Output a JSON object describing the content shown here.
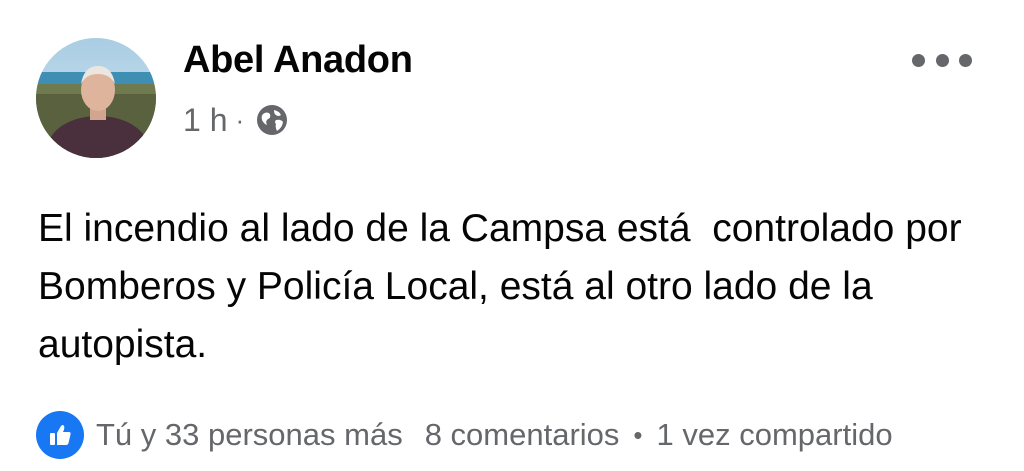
{
  "post": {
    "author_name": "Abel Anadon",
    "time": "1 h",
    "separator": "·",
    "privacy_icon": "globe-icon",
    "more_icon": "more-horizontal-icon",
    "text": "El incendio al lado de la Campsa está  controlado por Bomberos y Policía Local, está al otro lado de la autopista.",
    "reactions": {
      "icon": "like-icon",
      "label": "Tú y 33 personas más"
    },
    "comments_label": "8 comentarios",
    "dot": "•",
    "shares_label": "1 vez compartido"
  },
  "colors": {
    "like_blue": "#1877f2",
    "secondary_text": "#65676b",
    "primary_text": "#050505"
  }
}
